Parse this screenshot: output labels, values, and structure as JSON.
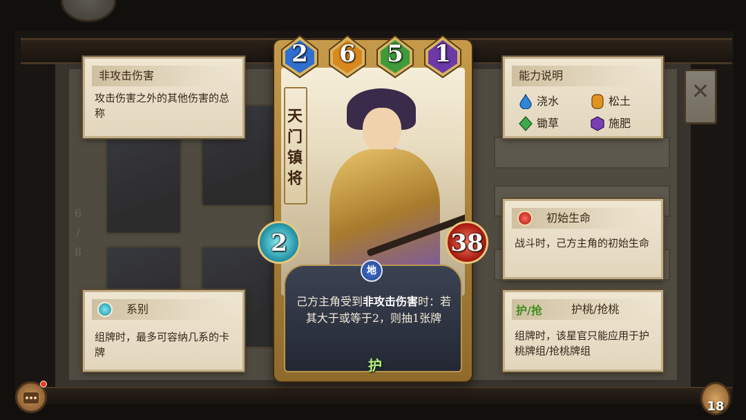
{
  "card": {
    "name": "天门镇将",
    "costs": [
      {
        "value": "2",
        "color": "#2f6fd0"
      },
      {
        "value": "6",
        "color": "#d8891d"
      },
      {
        "value": "5",
        "color": "#3f9a3a"
      },
      {
        "value": "1",
        "color": "#6b3aa6"
      }
    ],
    "attack": "2",
    "health": "38",
    "element": "地",
    "description_pre": "己方主角受到",
    "description_keyword": "非攻击伤害",
    "description_post": "时：若其大于或等于2，则抽1张牌",
    "tag": "护"
  },
  "panels": {
    "non_attack": {
      "title": "非攻击伤害",
      "body": "攻击伤害之外的其他伤害的总称"
    },
    "ability_legend": {
      "title": "能力说明",
      "items": [
        {
          "label": "浇水",
          "icon": "water-drop-icon",
          "color": "#2f86d6"
        },
        {
          "label": "松土",
          "icon": "soil-icon",
          "color": "#e0951f"
        },
        {
          "label": "锄草",
          "icon": "weed-icon",
          "color": "#3ea94a"
        },
        {
          "label": "施肥",
          "icon": "fertilize-icon",
          "color": "#7a3fb3"
        }
      ]
    },
    "initial_life": {
      "title": "初始生命",
      "body": "战斗时，己方主角的初始生命"
    },
    "faction": {
      "title": "系别",
      "body": "组牌时，最多可容纳几系的卡牌"
    },
    "protect_peach": {
      "badge_a": "护",
      "badge_b": "抢",
      "title": "护桃/抢桃",
      "body": "组牌时，该星官只能应用于护桃牌组/抢桃牌组"
    }
  },
  "page_indicator": {
    "current": "6",
    "total": "8"
  },
  "deck_count": "18"
}
